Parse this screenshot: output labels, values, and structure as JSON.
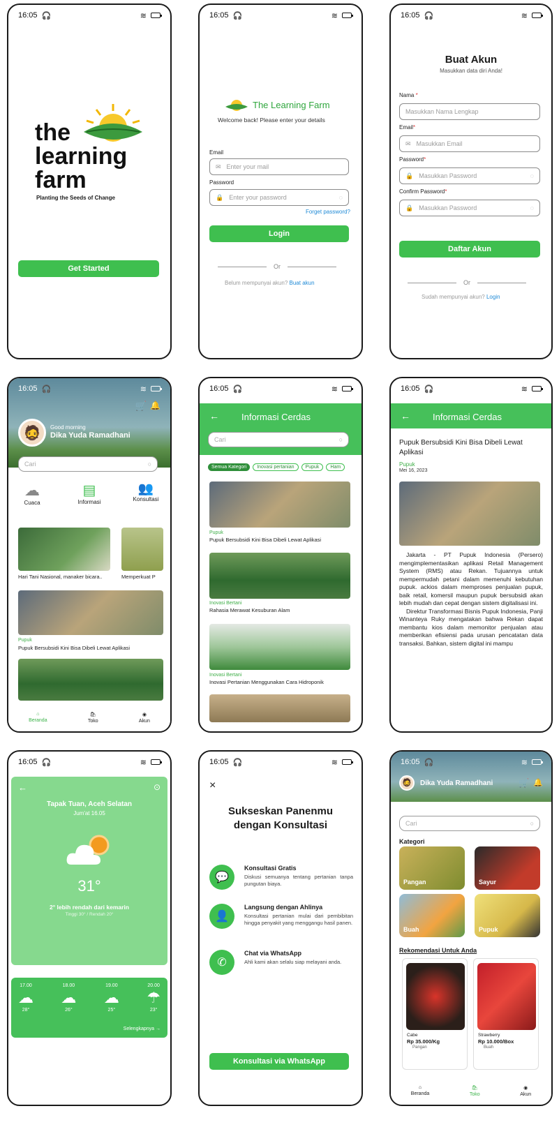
{
  "status_time": "16:05",
  "screens": {
    "splash": {
      "logo_line1": "the",
      "logo_line2": "learning",
      "logo_line3": "farm",
      "tagline": "Planting the Seeds of Change",
      "button": "Get Started"
    },
    "login": {
      "brand": "The Learning Farm",
      "subtitle": "Welcome back! Please enter your details",
      "email_label": "Email",
      "email_placeholder": "Enter your mail",
      "password_label": "Password",
      "password_placeholder": "Enter your password",
      "forgot": "Forget password?",
      "button": "Login",
      "or": "Or",
      "no_account": "Belum mempunyai akun?",
      "create_account": "Buat akun"
    },
    "register": {
      "title": "Buat Akun",
      "subtitle": "Masukkan data diri Anda!",
      "name_label": "Nama",
      "name_placeholder": "Masukkan Nama Lengkap",
      "email_label": "Email",
      "email_placeholder": "Masukkan Email",
      "password_label": "Password",
      "password_placeholder": "Masukkan Password",
      "confirm_label": "Confirm Password",
      "confirm_placeholder": "Masukkan Password",
      "required_mark": "*",
      "button": "Daftar Akun",
      "or": "Or",
      "has_account": "Sudah mempunyai akun?",
      "login_link": "Login"
    },
    "home": {
      "greeting": "Good morning",
      "user_name": "Dika Yuda Ramadhani",
      "search_placeholder": "Cari",
      "menu": [
        "Cuaca",
        "Informasi",
        "Konsultasi"
      ],
      "news": [
        "Hari Tani Nasional, manaker bicara..",
        "Memperkuat P"
      ],
      "featured_category": "Pupuk",
      "featured_title": "Pupuk Bersubsidi Kini Bisa Dibeli Lewat Aplikasi",
      "nav": [
        "Beranda",
        "Toko",
        "Akun"
      ]
    },
    "info_list": {
      "header": "Informasi Cerdas",
      "search_placeholder": "Cari",
      "chips": [
        "Semua Kategori",
        "Inovasi pertanian",
        "Pupuk",
        "Ham"
      ],
      "items": [
        {
          "category": "Pupuk",
          "title": "Pupuk Bersubsidi Kini Bisa Dibeli Lewat Aplikasi"
        },
        {
          "category": "Inovasi Bertani",
          "title": "Rahasia Merawat Kesuburan Alam"
        },
        {
          "category": "Inovasi Bertani",
          "title": "Inovasi Pertanian Menggunakan Cara Hidroponik"
        }
      ]
    },
    "article": {
      "header": "Informasi Cerdas",
      "title": "Pupuk Bersubsidi Kini Bisa Dibeli Lewat Aplikasi",
      "category": "Pupuk",
      "date": "Mei 16, 2023",
      "para1": "Jakarta - PT Pupuk Indonesia (Persero) mengimplementasikan aplikasi Retail Management System (RMS) atau Rekan. Tujuannya untuk mempermudah petani dalam memenuhi kebutuhan pupuk. ackios dalam memproses penjualan pupuk, baik retail, komersil maupun pupuk bersubsidi akan lebih mudah dan cepat dengan sistem digitalisasi ini.",
      "para2": "Direktur Transformasi Bisnis Pupuk Indonesia, Panji Winanteya Ruky mengatakan bahwa Rekan dapat membantu kios dalam memonitor penjualan atau memberikan efisiensi pada urusan pencatatan data transaksi. Bahkan, sistem digital ini mampu"
    },
    "weather": {
      "location": "Tapak Tuan, Aceh Selatan",
      "datetime": "Jum'at 16.05",
      "temp": "31°",
      "compare": "2° lebih rendah dari kemarin",
      "hilo": "Tinggi 30° / Rendah 20°",
      "hours": [
        "17.00",
        "18.00",
        "19.00",
        "20.00"
      ],
      "temps": [
        "28°",
        "26°",
        "25°",
        "23°"
      ],
      "more": "Selengkapnya →"
    },
    "consult": {
      "close": "×",
      "title_line1": "Sukseskan Panenmu",
      "title_line2": "dengan Konsultasi",
      "features": [
        {
          "title": "Konsultasi Gratis",
          "desc": "Diskusi semuanya tentang pertanian tanpa pungutan biaya."
        },
        {
          "title": "Langsung dengan Ahlinya",
          "desc": "Konsultasi pertanian mulai dari pembibitan hingga penyakit yang menggangu hasil panen."
        },
        {
          "title": "Chat via WhatsApp",
          "desc": "Ahli kami akan selalu siap melayani anda."
        }
      ],
      "button": "Konsultasi via WhatsApp"
    },
    "shop": {
      "user_name": "Dika Yuda Ramadhani",
      "search_placeholder": "Cari",
      "category_title": "Kategori",
      "categories": [
        "Pangan",
        "Sayur",
        "Buah",
        "Pupuk"
      ],
      "reco_title": "Rekomendasi Untuk Anda",
      "products": [
        {
          "name": "Cabe",
          "price": "Rp 35.000/Kg",
          "tag": "Pangan"
        },
        {
          "name": "Strawberry",
          "price": "Rp 10.000/Box",
          "tag": "Buah"
        }
      ],
      "nav": [
        "Beranda",
        "Toko",
        "Akun"
      ]
    }
  },
  "colors": {
    "primary": "#3fbf4f",
    "link": "#1f8ad6",
    "header": "#46c05a"
  }
}
